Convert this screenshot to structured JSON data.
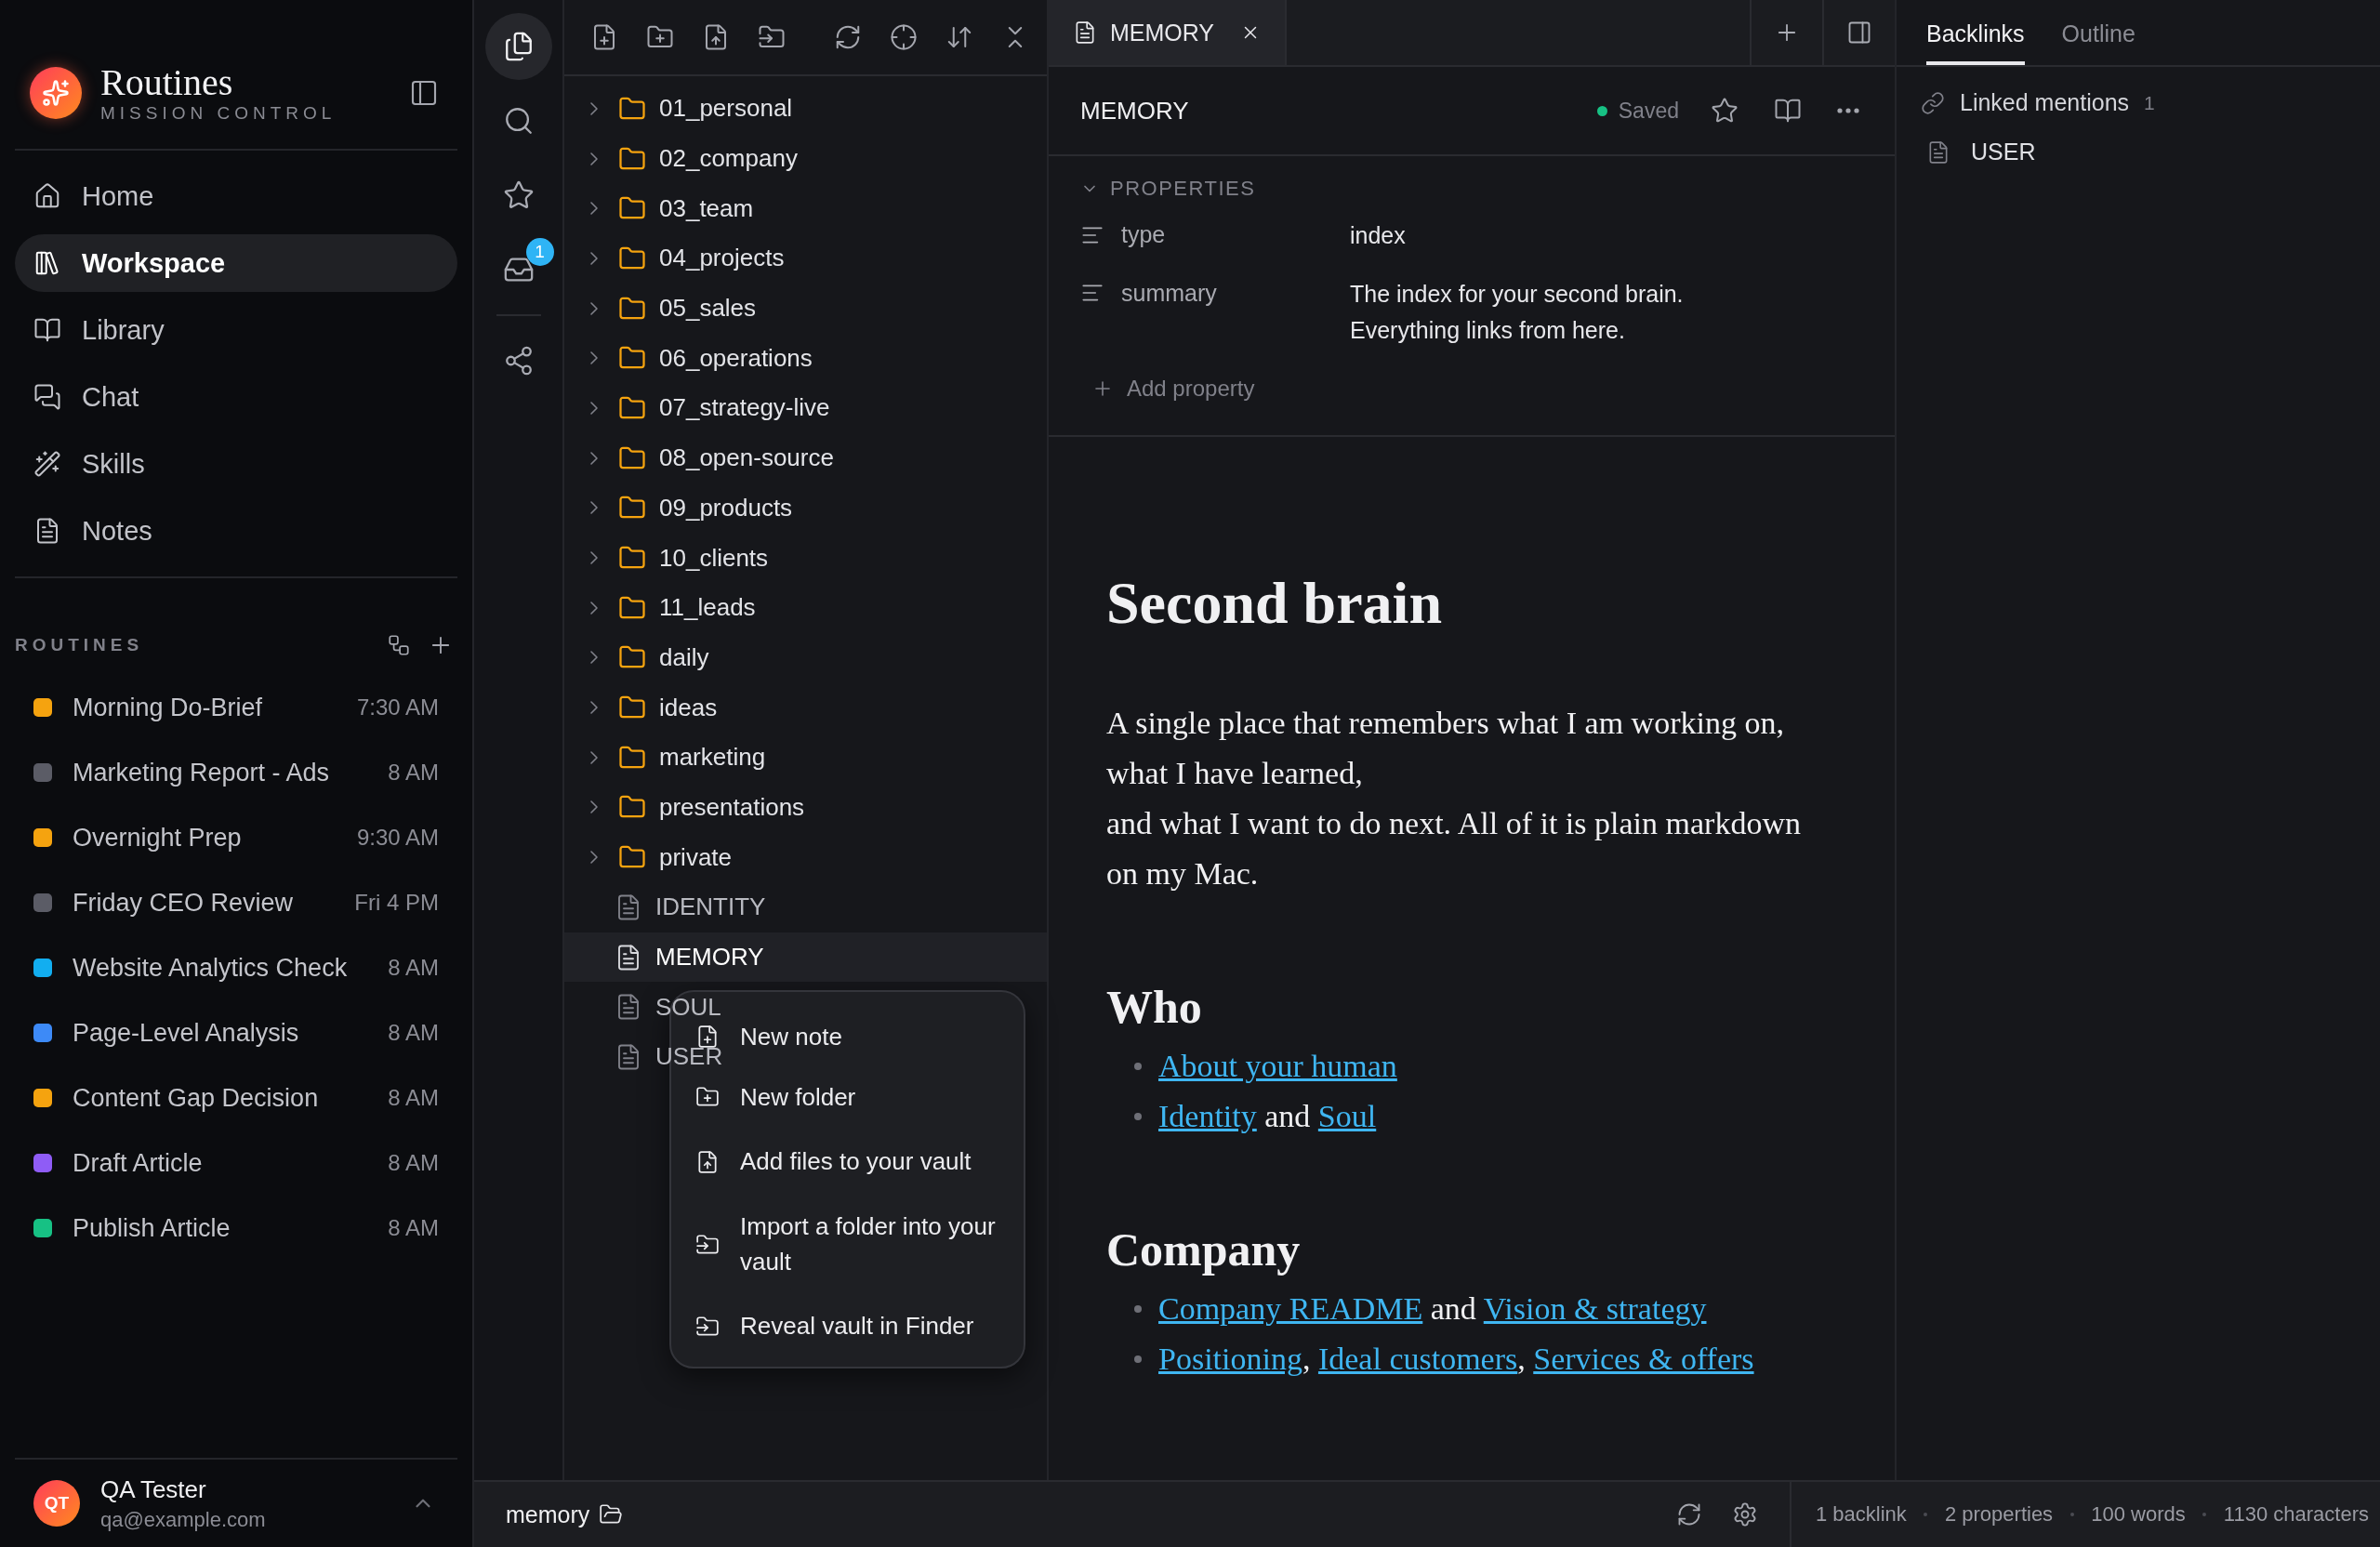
{
  "app": {
    "title": "Routines",
    "subtitle": "MISSION CONTROL"
  },
  "nav": [
    {
      "label": "Home",
      "selected": false
    },
    {
      "label": "Workspace",
      "selected": true
    },
    {
      "label": "Library",
      "selected": false
    },
    {
      "label": "Chat",
      "selected": false
    },
    {
      "label": "Skills",
      "selected": false
    },
    {
      "label": "Notes",
      "selected": false
    }
  ],
  "routines": {
    "title": "ROUTINES",
    "items": [
      {
        "name": "Morning Do-Brief",
        "time": "7:30 AM",
        "color": "#f5a30f"
      },
      {
        "name": "Marketing Report - Ads",
        "time": "8 AM",
        "color": "#5b5c66"
      },
      {
        "name": "Overnight Prep",
        "time": "9:30 AM",
        "color": "#f5a30f"
      },
      {
        "name": "Friday CEO Review",
        "time": "Fri 4 PM",
        "color": "#5b5c66"
      },
      {
        "name": "Website Analytics Check",
        "time": "8 AM",
        "color": "#12aef0"
      },
      {
        "name": "Page-Level Analysis",
        "time": "8 AM",
        "color": "#3d8af7"
      },
      {
        "name": "Content Gap Decision",
        "time": "8 AM",
        "color": "#f5a30f"
      },
      {
        "name": "Draft Article",
        "time": "8 AM",
        "color": "#8f5cf6"
      },
      {
        "name": "Publish Article",
        "time": "8 AM",
        "color": "#17c184"
      }
    ]
  },
  "user": {
    "initials": "QT",
    "name": "QA Tester",
    "email": "qa@example.com"
  },
  "rail": [
    {
      "selected": true
    },
    {
      "selected": false
    },
    {
      "selected": false
    },
    {
      "selected": false,
      "badge": "1"
    },
    {
      "selected": false
    }
  ],
  "file_tree": [
    {
      "kind": "folder",
      "name": "01_personal",
      "expanded": false,
      "selected": false
    },
    {
      "kind": "folder",
      "name": "02_company",
      "expanded": false,
      "selected": false
    },
    {
      "kind": "folder",
      "name": "03_team",
      "expanded": false,
      "selected": false
    },
    {
      "kind": "folder",
      "name": "04_projects",
      "expanded": false,
      "selected": false
    },
    {
      "kind": "folder",
      "name": "05_sales",
      "expanded": false,
      "selected": false
    },
    {
      "kind": "folder",
      "name": "06_operations",
      "expanded": false,
      "selected": false
    },
    {
      "kind": "folder",
      "name": "07_strategy-live",
      "expanded": false,
      "selected": false
    },
    {
      "kind": "folder",
      "name": "08_open-source",
      "expanded": false,
      "selected": false
    },
    {
      "kind": "folder",
      "name": "09_products",
      "expanded": false,
      "selected": false
    },
    {
      "kind": "folder",
      "name": "10_clients",
      "expanded": false,
      "selected": false
    },
    {
      "kind": "folder",
      "name": "11_leads",
      "expanded": false,
      "selected": false
    },
    {
      "kind": "folder",
      "name": "daily",
      "expanded": false,
      "selected": false
    },
    {
      "kind": "folder",
      "name": "ideas",
      "expanded": false,
      "selected": false
    },
    {
      "kind": "folder",
      "name": "marketing",
      "expanded": false,
      "selected": false
    },
    {
      "kind": "folder",
      "name": "presentations",
      "expanded": false,
      "selected": false
    },
    {
      "kind": "folder",
      "name": "private",
      "expanded": false,
      "selected": false
    },
    {
      "kind": "file",
      "name": "IDENTITY",
      "selected": false
    },
    {
      "kind": "file",
      "name": "MEMORY",
      "selected": true
    },
    {
      "kind": "file",
      "name": "SOUL",
      "selected": false
    },
    {
      "kind": "file",
      "name": "USER",
      "selected": false
    }
  ],
  "context_menu": [
    {
      "label": "New note"
    },
    {
      "label": "New folder"
    },
    {
      "label": "Add files to your vault"
    },
    {
      "label": "Import a folder into your vault"
    },
    {
      "label": "Reveal vault in Finder"
    }
  ],
  "editor": {
    "tabs": [
      {
        "label": "MEMORY",
        "selected": true
      }
    ],
    "title": "MEMORY",
    "status": "Saved",
    "properties_label": "PROPERTIES",
    "properties_expanded": true,
    "properties": [
      {
        "key": "type",
        "value": "index"
      },
      {
        "key": "summary",
        "value": "The index for your second brain.\nEverything links from here."
      }
    ],
    "add_property": "Add property",
    "content": [
      {
        "kind": "h1",
        "text": "Second brain"
      },
      {
        "kind": "paragraph",
        "text": "A single place that remembers what I am working on,\nwhat I have learned,\nand what I want to do next. All of it is plain markdown on my Mac."
      },
      {
        "kind": "h2",
        "text": "Who"
      },
      {
        "kind": "list",
        "items": [
          [
            {
              "text": "About your human",
              "link": true
            }
          ],
          [
            {
              "text": "Identity",
              "link": true
            },
            {
              "text": " and ",
              "link": false
            },
            {
              "text": "Soul",
              "link": true
            }
          ]
        ]
      },
      {
        "kind": "h2",
        "text": "Company"
      },
      {
        "kind": "list",
        "items": [
          [
            {
              "text": "Company README",
              "link": true
            },
            {
              "text": " and ",
              "link": false
            },
            {
              "text": "Vision & strategy",
              "link": true
            }
          ],
          [
            {
              "text": "Positioning",
              "link": true
            },
            {
              "text": ", ",
              "link": false
            },
            {
              "text": "Ideal customers",
              "link": true
            },
            {
              "text": ", ",
              "link": false
            },
            {
              "text": "Services & offers",
              "link": true
            }
          ]
        ]
      }
    ]
  },
  "right_panel": {
    "tabs": [
      {
        "label": "Backlinks",
        "selected": true
      },
      {
        "label": "Outline",
        "selected": false
      }
    ],
    "linked_mentions": {
      "label": "Linked mentions",
      "count": "1",
      "items": [
        {
          "name": "USER"
        }
      ]
    }
  },
  "status_bar": {
    "path": "memory",
    "stats": [
      "1 backlink",
      "2 properties",
      "100 words",
      "1130 characters"
    ]
  }
}
